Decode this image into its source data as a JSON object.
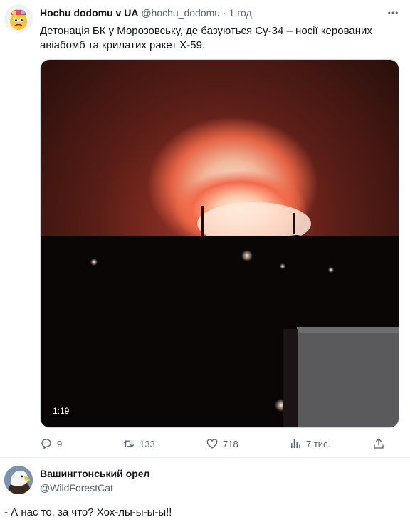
{
  "tweet": {
    "author_name": "Hochu dodomu v UA",
    "author_handle": "@hochu_dodomu",
    "separator": "·",
    "time": "1 год",
    "text": "Детонація БК у Морозовську, де базуються Су-34 – носії керованих авіабомб та крилатих ракет Х-59.",
    "avatar_icon": "emoji-face-icon",
    "media": {
      "type": "video",
      "duration": "1:19",
      "scene": "night-explosion"
    },
    "actions": {
      "replies": "9",
      "retweets": "133",
      "likes": "718",
      "views": "7 тис."
    }
  },
  "reply": {
    "author_name": "Вашингтонський орел",
    "author_handle": "@WildForestCat",
    "avatar_icon": "eagle-icon"
  },
  "caption": "- А нас то, за что? Хох-лы-ы-ы-ы!!",
  "colors": {
    "text": "#0f1419",
    "muted": "#536471",
    "border": "#cfd9de"
  }
}
